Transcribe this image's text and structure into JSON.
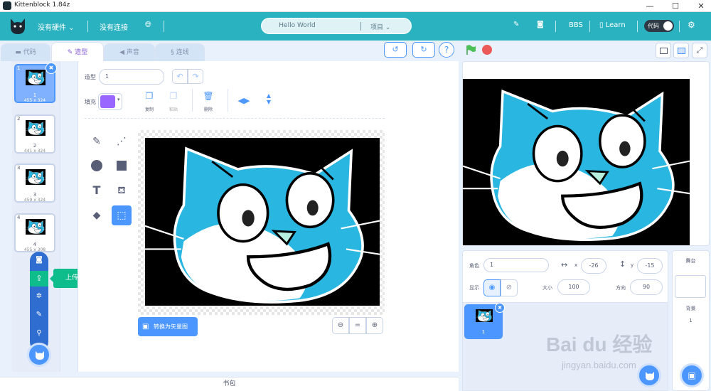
{
  "window": {
    "title": "Kittenblock 1.84z"
  },
  "menu": {
    "hardware": "没有硬件",
    "connect": "没有连接",
    "project_name": "Hello World",
    "project_menu": "项目",
    "bbs": "BBS",
    "learn": "Learn",
    "code_toggle": "代码"
  },
  "tabs": {
    "code": "代码",
    "costume": "造型",
    "sound": "声音",
    "connect": "连线"
  },
  "costumes": [
    {
      "num": "1",
      "name": "1",
      "size": "455 x 324"
    },
    {
      "num": "2",
      "name": "2",
      "size": "441 x 324"
    },
    {
      "num": "3",
      "name": "3",
      "size": "459 x 324"
    },
    {
      "num": "4",
      "name": "4",
      "size": "455 x 308"
    }
  ],
  "upload_tooltip": "上传造型",
  "editor": {
    "costume_label": "造型",
    "costume_value": "1",
    "fill_label": "填充",
    "fill_color": "#9966ff",
    "copy": "复制",
    "paste": "粘贴",
    "delete": "删除",
    "convert_vector": "转换为矢量图",
    "zoom_reset": "="
  },
  "backpack": "书包",
  "sprite_info": {
    "sprite_label": "角色",
    "sprite_name": "1",
    "x_label": "x",
    "x_value": "-26",
    "y_label": "y",
    "y_value": "-15",
    "show_label": "显示",
    "size_label": "大小",
    "size_value": "100",
    "direction_label": "方向",
    "direction_value": "90"
  },
  "sprites": [
    {
      "name": "1"
    }
  ],
  "stage_panel": {
    "title": "舞台",
    "backdrop_label": "背景",
    "backdrop_count": "1"
  },
  "watermark": {
    "brand": "Bai du 经验",
    "url": "jingyan.baidu.com"
  },
  "colors": {
    "header": "#2ab2c0",
    "accent": "#4c97ff",
    "green_flag": "#4cbf56",
    "stop": "#ec5959",
    "cat": "#29b6e0"
  }
}
